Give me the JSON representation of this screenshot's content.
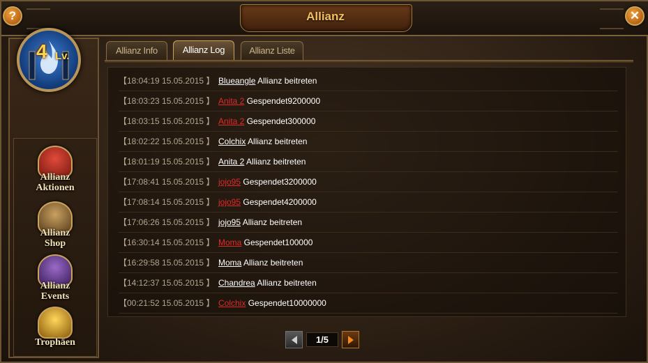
{
  "window": {
    "title": "Allianz",
    "help_symbol": "?",
    "close_symbol": "✕"
  },
  "sidebar": {
    "level": {
      "number": "4",
      "suffix": "Lv."
    },
    "emblem_icon": "blue-flame-shield-icon",
    "items": [
      {
        "line1": "Allianz",
        "line2": "Aktionen",
        "icon": "castle-icon",
        "color": "#c0302a"
      },
      {
        "line1": "Allianz",
        "line2": "Shop",
        "icon": "shop-icon",
        "color": "#8a6a3a"
      },
      {
        "line1": "Allianz",
        "line2": "Events",
        "icon": "events-icon",
        "color": "#6a3e8a"
      },
      {
        "line1": "Trophäen",
        "line2": "",
        "icon": "trophy-icon",
        "color": "#d8a92a"
      }
    ]
  },
  "tabs": [
    {
      "label": "Allianz Info",
      "active": false
    },
    {
      "label": "Allianz Log",
      "active": true
    },
    {
      "label": "Allianz Liste",
      "active": false
    }
  ],
  "log": [
    {
      "time": "【18:04:19 15.05.2015 】",
      "name": "Blueangle",
      "name_color": "white",
      "action": " Allianz beitreten"
    },
    {
      "time": "【18:03:23 15.05.2015 】",
      "name": "Anita 2",
      "name_color": "red",
      "action": " Gespendet9200000"
    },
    {
      "time": "【18:03:15 15.05.2015 】",
      "name": "Anita 2",
      "name_color": "red",
      "action": " Gespendet300000"
    },
    {
      "time": "【18:02:22 15.05.2015 】",
      "name": "Colchix",
      "name_color": "white",
      "action": " Allianz beitreten"
    },
    {
      "time": "【18:01:19 15.05.2015 】",
      "name": "Anita 2",
      "name_color": "white",
      "action": " Allianz beitreten"
    },
    {
      "time": "【17:08:41 15.05.2015 】",
      "name": "jojo95",
      "name_color": "red",
      "action": " Gespendet3200000"
    },
    {
      "time": "【17:08:14 15.05.2015 】",
      "name": "jojo95",
      "name_color": "red",
      "action": " Gespendet4200000"
    },
    {
      "time": "【17:06:26 15.05.2015 】",
      "name": "jojo95",
      "name_color": "white",
      "action": " Allianz beitreten"
    },
    {
      "time": "【16:30:14 15.05.2015 】",
      "name": "Moma",
      "name_color": "red",
      "action": " Gespendet100000"
    },
    {
      "time": "【16:29:58 15.05.2015 】",
      "name": "Moma",
      "name_color": "white",
      "action": " Allianz beitreten"
    },
    {
      "time": "【14:12:37 15.05.2015 】",
      "name": "Chandrea",
      "name_color": "white",
      "action": " Allianz beitreten"
    },
    {
      "time": "【00:21:52 15.05.2015 】",
      "name": "Colchix",
      "name_color": "red",
      "action": " Gespendet10000000"
    }
  ],
  "pagination": {
    "display": "1/5",
    "prev_icon": "arrow-left-icon",
    "next_icon": "arrow-right-icon"
  },
  "colors": {
    "title": "#f0c060",
    "donation_name": "#e02a2a",
    "timestamp": "#b3a68e"
  }
}
